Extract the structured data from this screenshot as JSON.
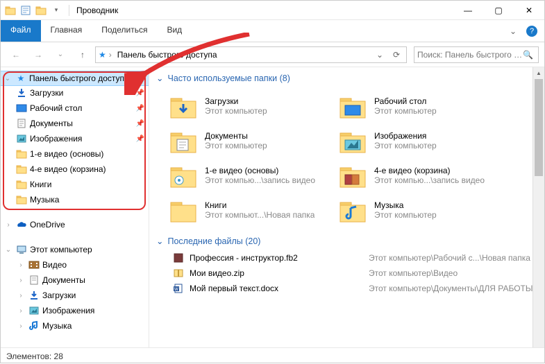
{
  "window": {
    "title": "Проводник",
    "min": "—",
    "max": "▢",
    "close": "✕",
    "chevron_down": "▾"
  },
  "ribbon": {
    "file": "Файл",
    "tabs": [
      "Главная",
      "Поделиться",
      "Вид"
    ],
    "expand": "⌄"
  },
  "address": {
    "back": "←",
    "forward": "→",
    "dropdown": "⌄",
    "up": "↑",
    "crumb_sep": "›",
    "location": "Панель быстрого доступа",
    "drop": "⌄",
    "refresh": "⟳",
    "search_placeholder": "Поиск: Панель быстрого до..."
  },
  "sidebar": {
    "quick_access": "Панель быстрого доступа",
    "items": [
      {
        "label": "Загрузки",
        "pinned": true
      },
      {
        "label": "Рабочий стол",
        "pinned": true
      },
      {
        "label": "Документы",
        "pinned": true
      },
      {
        "label": "Изображения",
        "pinned": true
      },
      {
        "label": "1-е видео (основы)",
        "pinned": false
      },
      {
        "label": "4-е видео (корзина)",
        "pinned": false
      },
      {
        "label": "Книги",
        "pinned": false
      },
      {
        "label": "Музыка",
        "pinned": false
      }
    ],
    "onedrive": "OneDrive",
    "this_pc": "Этот компьютер",
    "pc_items": [
      "Видео",
      "Документы",
      "Загрузки",
      "Изображения",
      "Музыка"
    ]
  },
  "content": {
    "freq_header": "Часто используемые папки (8)",
    "folders": [
      {
        "name": "Загрузки",
        "sub": "Этот компьютер"
      },
      {
        "name": "Рабочий стол",
        "sub": "Этот компьютер"
      },
      {
        "name": "Документы",
        "sub": "Этот компьютер"
      },
      {
        "name": "Изображения",
        "sub": "Этот компьютер"
      },
      {
        "name": "1-е видео (основы)",
        "sub": "Этот компью...\\запись видео"
      },
      {
        "name": "4-е видео (корзина)",
        "sub": "Этот компью...\\запись видео"
      },
      {
        "name": "Книги",
        "sub": "Этот компьют...\\Новая папка"
      },
      {
        "name": "Музыка",
        "sub": "Этот компьютер"
      }
    ],
    "recent_header": "Последние файлы (20)",
    "files": [
      {
        "name": "Профессия - инструктор.fb2",
        "path": "Этот компьютер\\Рабочий с...\\Новая папка"
      },
      {
        "name": "Мои видео.zip",
        "path": "Этот компьютер\\Видео"
      },
      {
        "name": "Мой первый текст.docx",
        "path": "Этот компьютер\\Документы\\ДЛЯ РАБОТЫ"
      }
    ]
  },
  "status": {
    "items": "Элементов: 28"
  },
  "glyphs": {
    "chev_right": "›",
    "chev_down": "⌄",
    "pin": "📌",
    "star": "★"
  }
}
